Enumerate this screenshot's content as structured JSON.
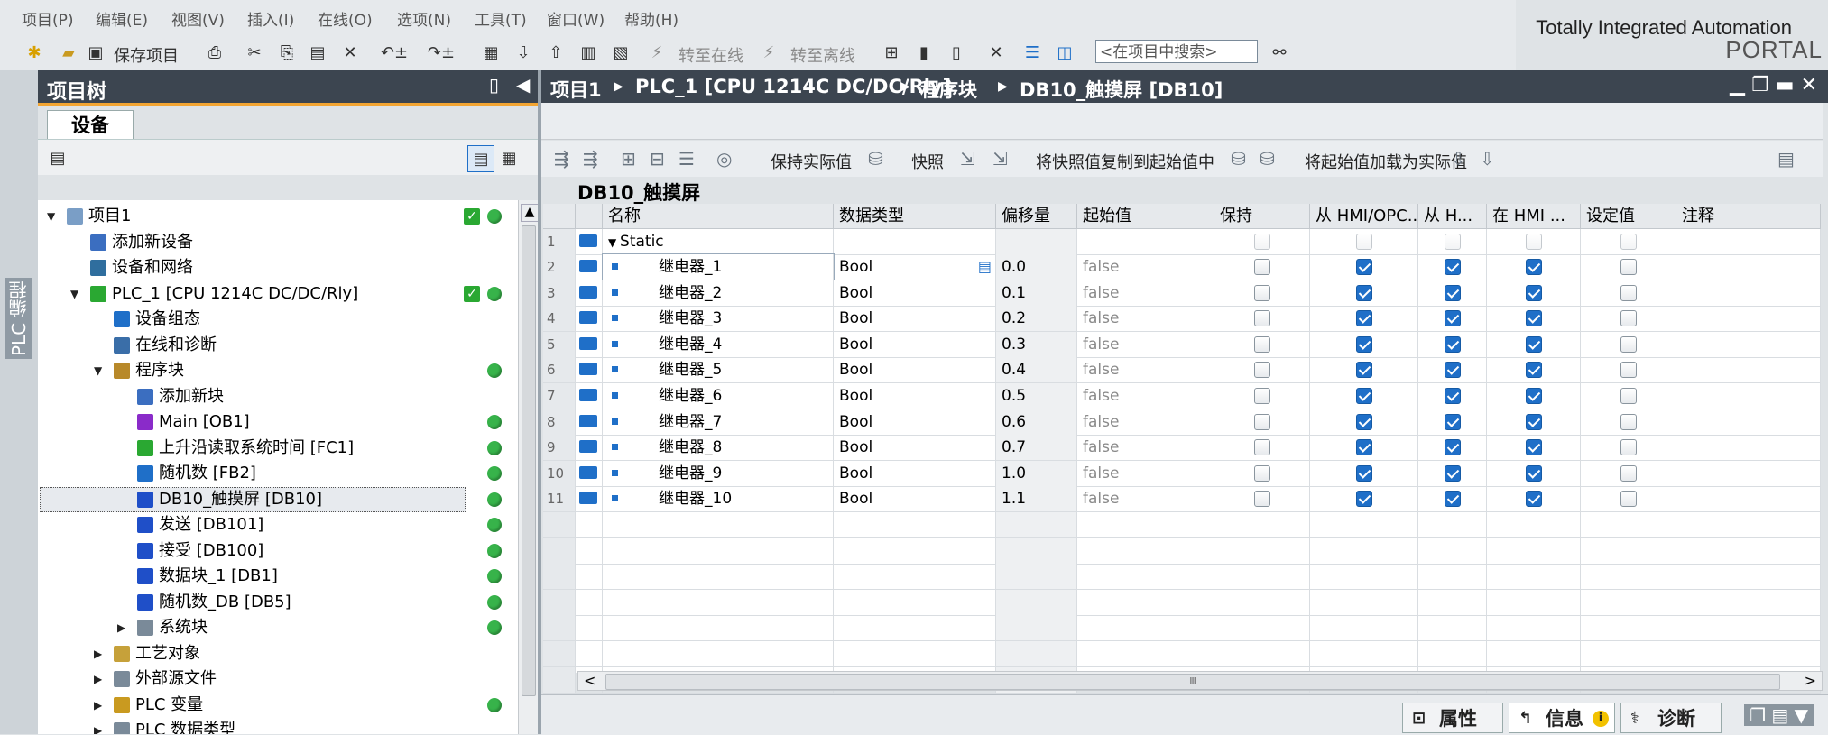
{
  "menu": [
    "项目(P)",
    "编辑(E)",
    "视图(V)",
    "插入(I)",
    "在线(O)",
    "选项(N)",
    "工具(T)",
    "窗口(W)",
    "帮助(H)"
  ],
  "brand": {
    "line1": "Totally Integrated Automation",
    "line2": "PORTAL"
  },
  "toolbar": {
    "save_label": "保存项目",
    "go_online": "转至在线",
    "go_offline": "转至离线",
    "search_placeholder": "<在项目中搜索>"
  },
  "vtab": {
    "label": "PLC 编程"
  },
  "tree": {
    "title": "项目树",
    "tab": "设备",
    "items": [
      {
        "label": "项目1",
        "indent": 0,
        "arrow": "down",
        "status": "check-dot"
      },
      {
        "label": "添加新设备",
        "indent": 1,
        "arrow": "",
        "status": ""
      },
      {
        "label": "设备和网络",
        "indent": 1,
        "arrow": "",
        "status": ""
      },
      {
        "label": "PLC_1 [CPU 1214C DC/DC/Rly]",
        "indent": 1,
        "arrow": "down",
        "status": "check-dot"
      },
      {
        "label": "设备组态",
        "indent": 2,
        "arrow": "",
        "status": ""
      },
      {
        "label": "在线和诊断",
        "indent": 2,
        "arrow": "",
        "status": ""
      },
      {
        "label": "程序块",
        "indent": 2,
        "arrow": "down",
        "status": "dot"
      },
      {
        "label": "添加新块",
        "indent": 3,
        "arrow": "",
        "status": ""
      },
      {
        "label": "Main [OB1]",
        "indent": 3,
        "arrow": "",
        "status": "dot"
      },
      {
        "label": "上升沿读取系统时间 [FC1]",
        "indent": 3,
        "arrow": "",
        "status": "dot"
      },
      {
        "label": "随机数 [FB2]",
        "indent": 3,
        "arrow": "",
        "status": "dot"
      },
      {
        "label": "DB10_触摸屏 [DB10]",
        "indent": 3,
        "arrow": "",
        "status": "dot"
      },
      {
        "label": "发送 [DB101]",
        "indent": 3,
        "arrow": "",
        "status": "dot"
      },
      {
        "label": "接受 [DB100]",
        "indent": 3,
        "arrow": "",
        "status": "dot"
      },
      {
        "label": "数据块_1 [DB1]",
        "indent": 3,
        "arrow": "",
        "status": "dot"
      },
      {
        "label": "随机数_DB [DB5]",
        "indent": 3,
        "arrow": "",
        "status": "dot"
      },
      {
        "label": "系统块",
        "indent": 3,
        "arrow": "right",
        "status": "dot"
      },
      {
        "label": "工艺对象",
        "indent": 2,
        "arrow": "right",
        "status": ""
      },
      {
        "label": "外部源文件",
        "indent": 2,
        "arrow": "right",
        "status": ""
      },
      {
        "label": "PLC 变量",
        "indent": 2,
        "arrow": "right",
        "status": "dot"
      },
      {
        "label": "PLC 数据类型",
        "indent": 2,
        "arrow": "right",
        "status": ""
      }
    ]
  },
  "editor": {
    "breadcrumb": [
      "项目1",
      "PLC_1 [CPU 1214C DC/DC/Rly]",
      "程序块",
      "DB10_触摸屏 [DB10]"
    ],
    "toolbar": {
      "keep_actual": "保持实际值",
      "snapshot": "快照",
      "copy_snapshot": "将快照值复制到起始值中",
      "load_start": "将起始值加载为实际值"
    },
    "db_title": "DB10_触摸屏",
    "columns": [
      "名称",
      "数据类型",
      "偏移量",
      "起始值",
      "保持",
      "从 HMI/OPC..",
      "从 H...",
      "在 HMI ...",
      "设定值",
      "注释"
    ],
    "static_row": {
      "num": "1",
      "name": "Static"
    },
    "rows": [
      {
        "num": "2",
        "name": "继电器_1",
        "type": "Bool",
        "offset": "0.0",
        "start": "false"
      },
      {
        "num": "3",
        "name": "继电器_2",
        "type": "Bool",
        "offset": "0.1",
        "start": "false"
      },
      {
        "num": "4",
        "name": "继电器_3",
        "type": "Bool",
        "offset": "0.2",
        "start": "false"
      },
      {
        "num": "5",
        "name": "继电器_4",
        "type": "Bool",
        "offset": "0.3",
        "start": "false"
      },
      {
        "num": "6",
        "name": "继电器_5",
        "type": "Bool",
        "offset": "0.4",
        "start": "false"
      },
      {
        "num": "7",
        "name": "继电器_6",
        "type": "Bool",
        "offset": "0.5",
        "start": "false"
      },
      {
        "num": "8",
        "name": "继电器_7",
        "type": "Bool",
        "offset": "0.6",
        "start": "false"
      },
      {
        "num": "9",
        "name": "继电器_8",
        "type": "Bool",
        "offset": "0.7",
        "start": "false"
      },
      {
        "num": "10",
        "name": "继电器_9",
        "type": "Bool",
        "offset": "1.0",
        "start": "false"
      },
      {
        "num": "11",
        "name": "继电器_10",
        "type": "Bool",
        "offset": "1.1",
        "start": "false"
      }
    ],
    "scroll_thumb": "Ⅲ"
  },
  "bottom_tabs": {
    "properties": "属性",
    "info": "信息",
    "diagnostics": "诊断"
  },
  "colors": {
    "title_bar": "#3c4550",
    "accent_orange": "#f3a532",
    "status_green": "#37b34a",
    "checkbox_blue": "#1f6fc8"
  }
}
